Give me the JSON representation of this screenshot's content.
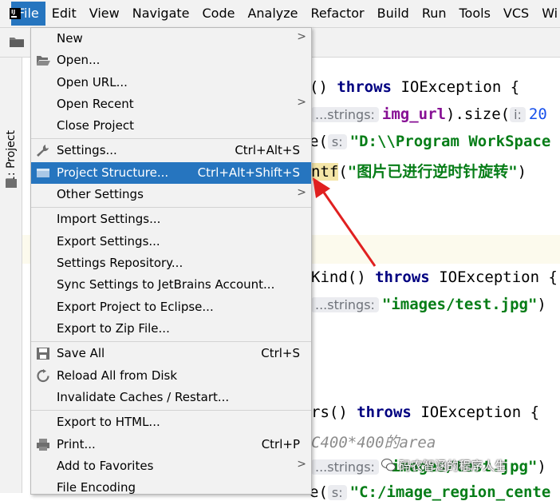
{
  "menubar": {
    "items": [
      "File",
      "Edit",
      "View",
      "Navigate",
      "Code",
      "Analyze",
      "Refactor",
      "Build",
      "Run",
      "Tools",
      "VCS",
      "Wi"
    ],
    "active": "File"
  },
  "sidebar": {
    "project_tab": "1: Project"
  },
  "file_menu": {
    "items": [
      {
        "label": "New",
        "submenu": ">"
      },
      {
        "label": "Open..."
      },
      {
        "label": "Open URL..."
      },
      {
        "label": "Open Recent",
        "submenu": ">"
      },
      {
        "label": "Close Project"
      },
      {
        "label": "Settings...",
        "shortcut": "Ctrl+Alt+S"
      },
      {
        "label": "Project Structure...",
        "shortcut": "Ctrl+Alt+Shift+S"
      },
      {
        "label": "Other Settings",
        "submenu": ">"
      },
      {
        "label": "Import Settings..."
      },
      {
        "label": "Export Settings..."
      },
      {
        "label": "Settings Repository..."
      },
      {
        "label": "Sync Settings to JetBrains Account..."
      },
      {
        "label": "Export Project to Eclipse..."
      },
      {
        "label": "Export to Zip File..."
      },
      {
        "label": "Save All",
        "shortcut": "Ctrl+S"
      },
      {
        "label": "Reload All from Disk"
      },
      {
        "label": "Invalidate Caches / Restart..."
      },
      {
        "label": "Export to HTML..."
      },
      {
        "label": "Print...",
        "shortcut": "Ctrl+P"
      },
      {
        "label": "Add to Favorites",
        "submenu": ">"
      },
      {
        "label": "File Encoding"
      }
    ],
    "selected": "Project Structure..."
  },
  "editor": {
    "line1": {
      "a": "()",
      "b": "throws",
      "c": "IOException {"
    },
    "line2": {
      "hint": "...strings:",
      "a": "img_url",
      "b": ").size(",
      "hint2": "i:",
      "c": "20"
    },
    "line3": {
      "a": "e(",
      "hint": "s:",
      "b": "\"D:\\\\Program WorkSpace"
    },
    "line4": {
      "a": "ntf",
      "b": "(",
      "c": "\"图片已进行逆时针旋转\"",
      "d": ")"
    },
    "line5": {
      "a": "Kind()",
      "b": "throws",
      "c": "IOException",
      "d": "{"
    },
    "line6": {
      "hint": "...strings:",
      "a": "\"images/test.jpg\"",
      "b": ")"
    },
    "line7": {
      "a": "rs()",
      "b": "throws",
      "c": "IOException {"
    },
    "line8": {
      "a": "C400*400的area"
    },
    "line9": {
      "hint": "...strings:",
      "a": "\"images/test.jpg\"",
      "b": ")"
    },
    "line10": {
      "a": "e(",
      "hint": "s:",
      "b": "\"C:/image_region_cente"
    }
  },
  "watermark": "码农智涵的程序人生",
  "colors": {
    "accent": "#2675bf",
    "keyword": "#000080",
    "string": "#067d17",
    "field": "#871094",
    "arrow": "#e02020"
  }
}
